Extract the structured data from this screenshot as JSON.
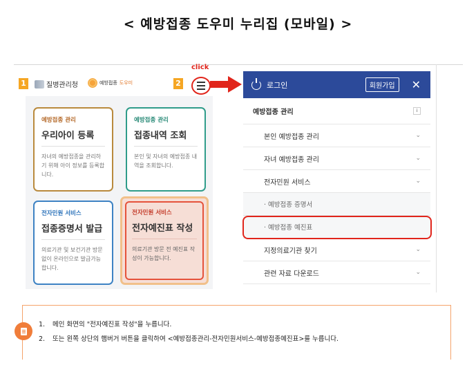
{
  "title": "< 예방접종 도우미 누리집 (모바일) >",
  "screenshot": {
    "badge1": "1",
    "badge2": "2",
    "logo_agency": "질병관리청",
    "logo_site_prefix": "예방접종",
    "logo_site_suffix": "도우미",
    "click_label": "click",
    "cards": [
      {
        "category": "예방접종 관리",
        "title": "우리아이 등록",
        "desc": "자녀의 예방접종을 관리하기 위해 아이 정보를 등록합니다."
      },
      {
        "category": "예방접종 관리",
        "title": "접종내역 조회",
        "desc": "본인 및 자녀의 예방접종 내역을 조회합니다."
      },
      {
        "category": "전자민원 서비스",
        "title": "접종증명서 발급",
        "desc": "의료기관 및 보건기관 방문 없이 온라인으로 발급가능합니다."
      },
      {
        "category": "전자민원 서비스",
        "title": "전자예진표 작성",
        "desc": "의료기관 방문 전 예진표 작성이 가능합니다."
      }
    ],
    "menu": {
      "login": "로그인",
      "signup": "회원가입",
      "close": "✕",
      "section_title": "예방접종 관리",
      "info": "i",
      "items": [
        {
          "label": "본인 예방접종 관리"
        },
        {
          "label": "자녀 예방접종 관리"
        },
        {
          "label": "전자민원 서비스"
        },
        {
          "label": "· 예방접종 증명서"
        },
        {
          "label": "· 예방접종 예진표"
        },
        {
          "label": "지정의료기관 찾기"
        },
        {
          "label": "관련 자료 다운로드"
        }
      ],
      "chevron": "⌄"
    }
  },
  "instructions": [
    {
      "num": "1.",
      "text": "메인 화면의 \"전자예진표 작성\"을 누릅니다."
    },
    {
      "num": "2.",
      "text": "또는 왼쪽 상단의 햄버거 버튼을 클릭하여 <예방접종관리-전자민원서비스-예방접종예진표>를 누릅니다."
    }
  ],
  "colors": {
    "accent_red": "#e1251b",
    "menu_blue": "#2c4a9a",
    "orange": "#f07d3a"
  }
}
